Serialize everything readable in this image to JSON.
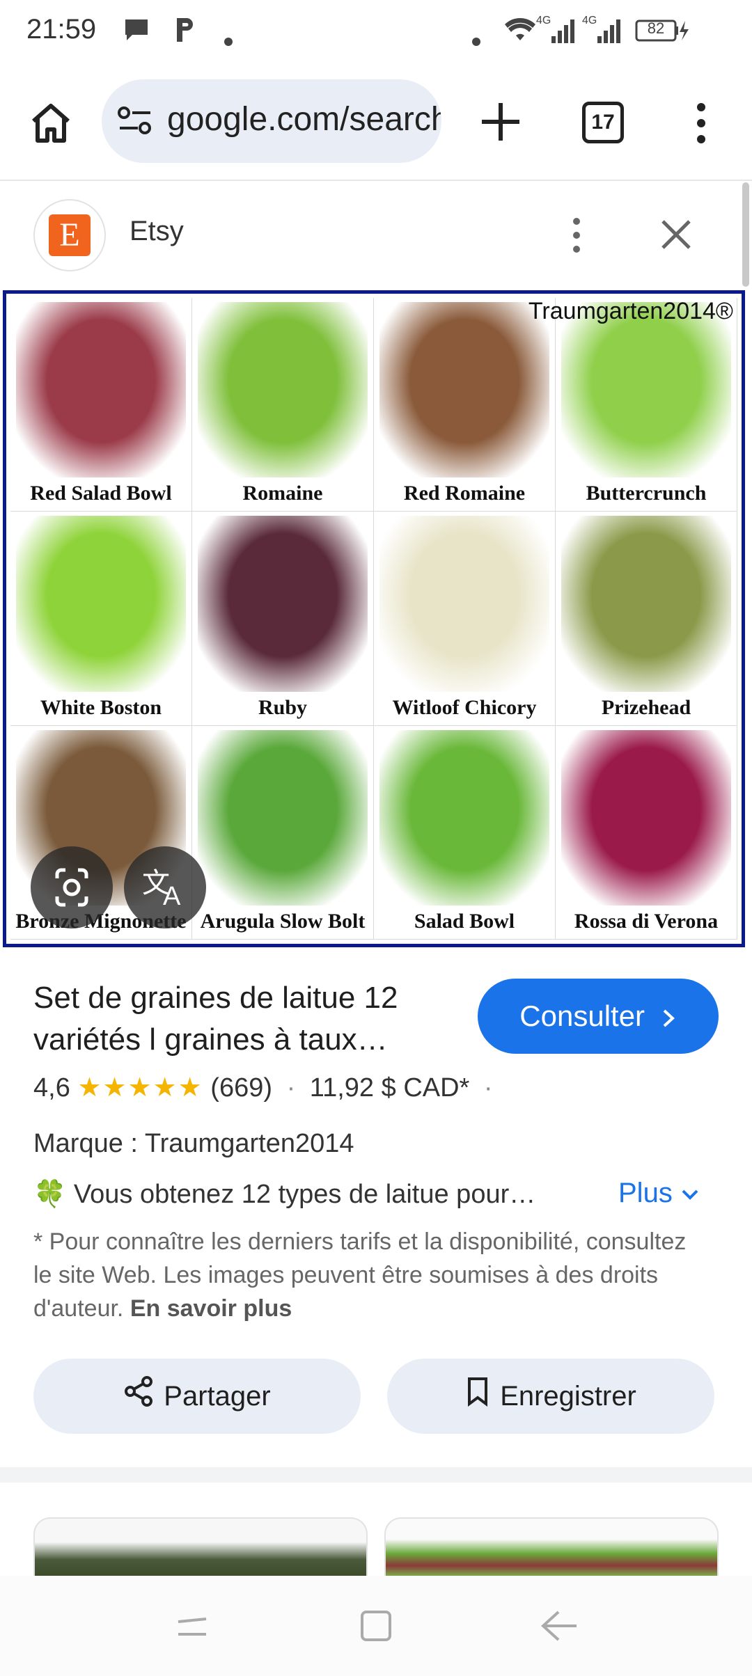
{
  "status_bar": {
    "time": "21:59",
    "battery": "82",
    "net1": "4G",
    "net2": "4G"
  },
  "browser": {
    "url": "google.com/search",
    "tab_count": "17"
  },
  "source": {
    "logo_letter": "E",
    "name": "Etsy"
  },
  "image": {
    "watermark": "Traumgarten2014®",
    "cells": [
      {
        "label": "Red Salad Bowl",
        "color": "#9b3b4a"
      },
      {
        "label": "Romaine",
        "color": "#7fbf3a"
      },
      {
        "label": "Red Romaine",
        "color": "#8a5a3a"
      },
      {
        "label": "Buttercrunch",
        "color": "#8fcf4a"
      },
      {
        "label": "White Boston",
        "color": "#8fd33a"
      },
      {
        "label": "Ruby",
        "color": "#5a2a3a"
      },
      {
        "label": "Witloof Chicory",
        "color": "#e8e4c8"
      },
      {
        "label": "Prizehead",
        "color": "#8a9a4a"
      },
      {
        "label": "Bronze Mignonette",
        "color": "#7a5a3a"
      },
      {
        "label": "Arugula Slow Bolt",
        "color": "#5aa83a"
      },
      {
        "label": "Salad Bowl",
        "color": "#6ab83a"
      },
      {
        "label": "Rossa di Verona",
        "color": "#9a1a4a"
      }
    ]
  },
  "product": {
    "title": "Set de graines de laitue 12 variétés l graines à taux…",
    "consult_label": "Consulter",
    "rating_value": "4,6",
    "stars": "★★★★★",
    "review_count": "(669)",
    "price": "11,92 $ CAD*",
    "brand": "Marque : Traumgarten2014",
    "clover": "🍀",
    "description": "Vous obtenez 12 types de laitue pour…",
    "more_label": "Plus",
    "note": "* Pour connaître les derniers tarifs et la disponibilité, consultez le site Web. Les images peuvent être soumises à des droits d'auteur.",
    "learn_more": "En savoir plus"
  },
  "actions": {
    "share_label": "Partager",
    "save_label": "Enregistrer"
  },
  "colors": {
    "accent": "#1a73e8",
    "frame": "#0a1a8c",
    "etsy": "#f1641e",
    "star": "#f5b400"
  }
}
